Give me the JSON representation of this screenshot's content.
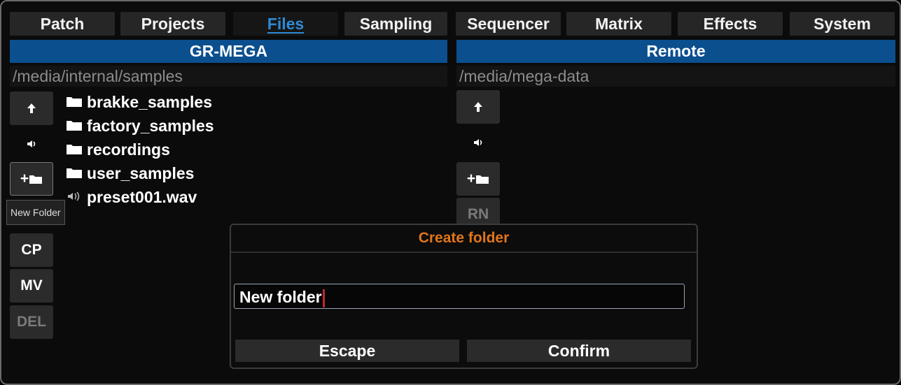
{
  "tabs": [
    {
      "label": "Patch"
    },
    {
      "label": "Projects"
    },
    {
      "label": "Files"
    },
    {
      "label": "Sampling"
    },
    {
      "label": "Sequencer"
    },
    {
      "label": "Matrix"
    },
    {
      "label": "Effects"
    },
    {
      "label": "System"
    }
  ],
  "active_tab": "Files",
  "left_pane": {
    "title": "GR-MEGA",
    "path": "/media/internal/samples",
    "buttons": {
      "up_icon": "up-arrow-icon",
      "preview_icon": "speaker-icon",
      "new_folder_icon": "plus-folder-icon",
      "new_folder_plus": "+",
      "copy": "CP",
      "move": "MV",
      "delete": "DEL"
    },
    "tooltip": "New Folder",
    "entries": [
      {
        "name": "brakke_samples",
        "icon": "folder-icon"
      },
      {
        "name": "factory_samples",
        "icon": "folder-icon"
      },
      {
        "name": "recordings",
        "icon": "folder-icon"
      },
      {
        "name": "user_samples",
        "icon": "folder-icon"
      },
      {
        "name": "preset001.wav",
        "icon": "audio-file-icon"
      }
    ]
  },
  "right_pane": {
    "title": "Remote",
    "path": "/media/mega-data",
    "buttons": {
      "up_icon": "up-arrow-icon",
      "preview_icon": "speaker-icon",
      "new_folder_icon": "plus-folder-icon",
      "new_folder_plus": "+",
      "rename": "RN"
    }
  },
  "dialog": {
    "title": "Create folder",
    "input_value": "New folder",
    "escape_label": "Escape",
    "confirm_label": "Confirm"
  },
  "colors": {
    "header_blue": "#0b4f8e",
    "active_tab": "#2e8ad6",
    "dialog_title": "#e2751a",
    "caret": "#c0282c"
  }
}
